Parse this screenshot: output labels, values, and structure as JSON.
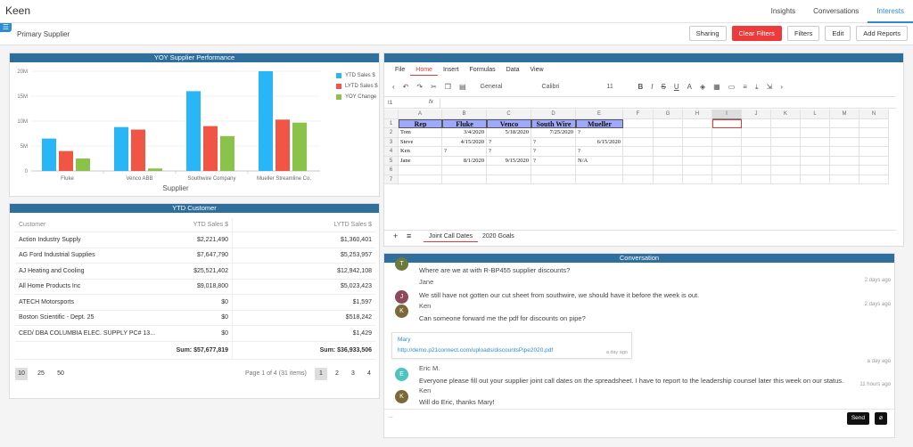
{
  "app": {
    "brand": "Keen"
  },
  "topnav": {
    "items": [
      "Insights",
      "Conversations",
      "Interests"
    ],
    "active": 2
  },
  "subbar": {
    "title": "Primary Supplier",
    "buttons": {
      "sharing": "Sharing",
      "clear": "Clear Filters",
      "filters": "Filters",
      "edit": "Edit",
      "add": "Add Reports"
    }
  },
  "chart_panel": {
    "title": "YOY Supplier Performance"
  },
  "chart_data": {
    "type": "bar",
    "categories": [
      "Fluke",
      "Venco ABB",
      "Southwire Company",
      "Mueller Streamline Co."
    ],
    "series": [
      {
        "name": "YTD Sales $",
        "values": [
          6.5,
          8.8,
          16.0,
          20.0
        ],
        "color": "#29b6f6"
      },
      {
        "name": "LYTD Sales $",
        "values": [
          4.0,
          8.3,
          9.0,
          10.3
        ],
        "color": "#f05545"
      },
      {
        "name": "YOY Change",
        "values": [
          2.5,
          0.5,
          7.0,
          9.7
        ],
        "color": "#8bc34a"
      }
    ],
    "xlabel": "Supplier",
    "ylabel": "",
    "yticks": [
      "0",
      "5M",
      "10M",
      "15M",
      "20M"
    ],
    "ylim": [
      0,
      20
    ],
    "legend": "right",
    "grid": true
  },
  "customer_panel": {
    "title": "YTD Customer",
    "columns": [
      "Customer",
      "YTD Sales $",
      "LYTD Sales $"
    ],
    "rows": [
      [
        "Action Industry Supply",
        "$2,221,490",
        "$1,360,401"
      ],
      [
        "AG Ford Industrial Supplies",
        "$7,647,790",
        "$5,253,957"
      ],
      [
        "AJ Heating and Cooling",
        "$25,521,402",
        "$12,942,108"
      ],
      [
        "All Home Products Inc",
        "$9,018,800",
        "$5,023,423"
      ],
      [
        "ATECH Motorsports",
        "$0",
        "$1,597"
      ],
      [
        "Boston Scientific - Dept. 25",
        "$0",
        "$518,242"
      ],
      [
        "CED/ DBA COLUMBIA ELEC. SUPPLY PC# 13...",
        "$0",
        "$1,429"
      ]
    ],
    "sum_ytd": "Sum: $57,677,819",
    "sum_lytd": "Sum: $36,933,506",
    "page_sizes": [
      "10",
      "25",
      "50"
    ],
    "page_info": "Page 1 of 4 (31 items)",
    "pages": [
      "1",
      "2",
      "3",
      "4"
    ]
  },
  "spreadsheet": {
    "menus": [
      "File",
      "Home",
      "Insert",
      "Formulas",
      "Data",
      "View"
    ],
    "active_menu": "Home",
    "toolbar": {
      "format": "General",
      "font": "Calibri",
      "size": "11"
    },
    "cell_ref": "I1",
    "fx": "fx",
    "columns": [
      "A",
      "B",
      "C",
      "D",
      "E",
      "F",
      "G",
      "H",
      "I",
      "J",
      "K",
      "L",
      "M",
      "N"
    ],
    "row_numbers": [
      "1",
      "2",
      "3",
      "4",
      "5",
      "6",
      "7"
    ],
    "header_row": [
      "Rep",
      "Fluke",
      "Venco",
      "South Wire",
      "Mueller"
    ],
    "data": [
      [
        "Tom",
        "3/4/2020",
        "5/18/2020",
        "7/25/2020",
        "?"
      ],
      [
        "Steve",
        "4/15/2020",
        "?",
        "?",
        "6/15/2020"
      ],
      [
        "Ken",
        "?",
        "?",
        "?",
        "?"
      ],
      [
        "Jane",
        "8/1/2020",
        "9/15/2020",
        "?",
        "N/A"
      ]
    ],
    "sheet_tabs": [
      "Joint Call Dates",
      "2020 Goals"
    ],
    "active_sheet": 0
  },
  "conversation": {
    "title": "Conversation",
    "messages": [
      {
        "initial": "T",
        "name": "",
        "text": "Where are we at with R-BP455 supplier discounts?",
        "time": "",
        "color": "#6d7a3e"
      },
      {
        "initial": "J",
        "name": "Jane",
        "text": "We still have not gotten our cut sheet from southwire, we should have it before the week is out.",
        "time": "2 days ago",
        "color": "#8d4a5a"
      },
      {
        "initial": "K",
        "name": "Ken",
        "text": "Can someone forward me the pdf for discounts on pipe?",
        "time": "2 days ago",
        "color": "#7a6a3a"
      },
      {
        "initial": "E",
        "name": "Eric M.",
        "text": "Everyone please fill out your supplier joint call dates on the spreadsheet. I have to report to the leadership counsel later this week on our status.",
        "time": "a day ago",
        "color": "#4fc3c0"
      },
      {
        "initial": "K",
        "name": "Ken",
        "text": "Will do Eric, thanks Mary!",
        "time": "11 hours ago",
        "color": "#7a6a3a"
      }
    ],
    "attachment": {
      "name": "Mary",
      "link": "http://demo.p21connect.com/uploads/discountsPipe2020.pdf",
      "time": "a day ago"
    },
    "input_placeholder": "...",
    "send_label": "Send"
  }
}
